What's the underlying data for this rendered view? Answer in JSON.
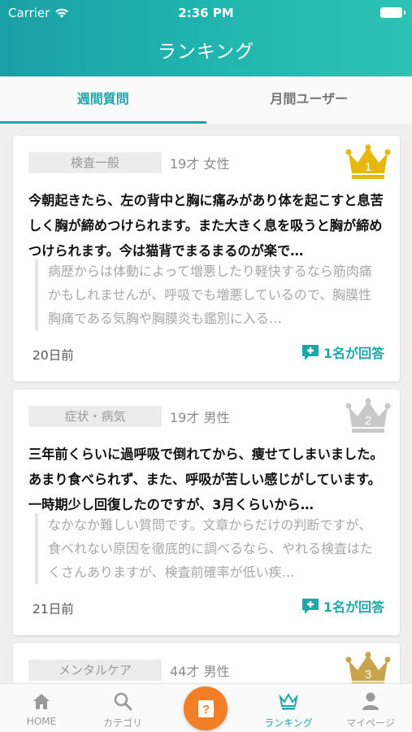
{
  "status": {
    "carrier": "Carrier",
    "time": "2:36 PM"
  },
  "header": {
    "title": "ランキング"
  },
  "tabs": [
    {
      "label": "週間質問",
      "active": true
    },
    {
      "label": "月間ユーザー",
      "active": false
    }
  ],
  "cards": [
    {
      "rank": "1",
      "crown_color": "#e6b80c",
      "category": "検査一般",
      "demographic": "19才 女性",
      "question": "今朝起きたら、左の背中と胸に痛みがあり体を起こすと息苦しく胸が締めつけられます。また大きく息を吸うと胸が締めつけられます。今は猫背でまるまるのが楽で…",
      "answer": "病歴からは体動によって増悪したり軽快するなら筋肉痛かもしれませんが、呼吸でも増悪しているので、胸膜性胸痛である気胸や胸膜炎も鑑別に入る…",
      "date": "20日前",
      "answer_count": "1名が回答"
    },
    {
      "rank": "2",
      "crown_color": "#c8c8c8",
      "category": "症状・病気",
      "demographic": "19才 男性",
      "question": "三年前くらいに過呼吸で倒れてから、痩せてしまいました。あまり食べられず、また、呼吸が苦しい感じがしています。一時期少し回復したのですが、3月くらいから…",
      "answer": "なかなか難しい質問です。文章からだけの判断ですが、食べれない原因を徹底的に調べるなら、やれる検査はたくさんありますが、検査前確率が低い疾…",
      "date": "21日前",
      "answer_count": "1名が回答"
    },
    {
      "rank": "3",
      "crown_color": "#c9a44a",
      "category": "メンタルケア",
      "demographic": "44才 男性"
    }
  ],
  "nav": [
    {
      "label": "HOME",
      "icon": "home-icon"
    },
    {
      "label": "カテゴリ",
      "icon": "search-icon"
    },
    {
      "label": "",
      "icon": "question-icon"
    },
    {
      "label": "ランキング",
      "icon": "crown-icon",
      "active": true
    },
    {
      "label": "マイページ",
      "icon": "person-icon"
    }
  ]
}
